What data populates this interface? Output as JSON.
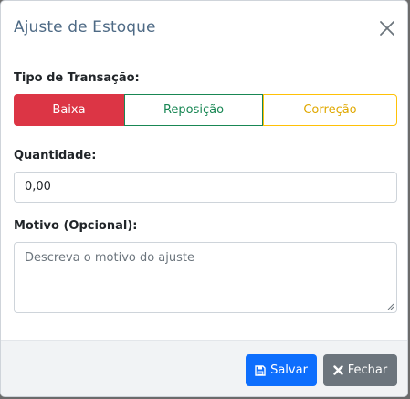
{
  "modal": {
    "title": "Ajuste de Estoque"
  },
  "transaction": {
    "label": "Tipo de Transação:",
    "options": [
      {
        "label": "Baixa",
        "selected": true,
        "color": "#dc3545"
      },
      {
        "label": "Reposição",
        "selected": false,
        "color": "#198754"
      },
      {
        "label": "Correção",
        "selected": false,
        "color": "#ffc107"
      }
    ]
  },
  "quantity": {
    "label": "Quantidade:",
    "value": "0,00"
  },
  "reason": {
    "label": "Motivo (Opcional):",
    "placeholder": "Descreva o motivo do ajuste",
    "value": ""
  },
  "footer": {
    "save_label": "Salvar",
    "save_icon": "floppy-disk-icon",
    "close_label": "Fechar",
    "close_icon": "x-icon"
  },
  "colors": {
    "primary": "#0d6efd",
    "secondary": "#6c757d",
    "title": "#4e6a85"
  }
}
